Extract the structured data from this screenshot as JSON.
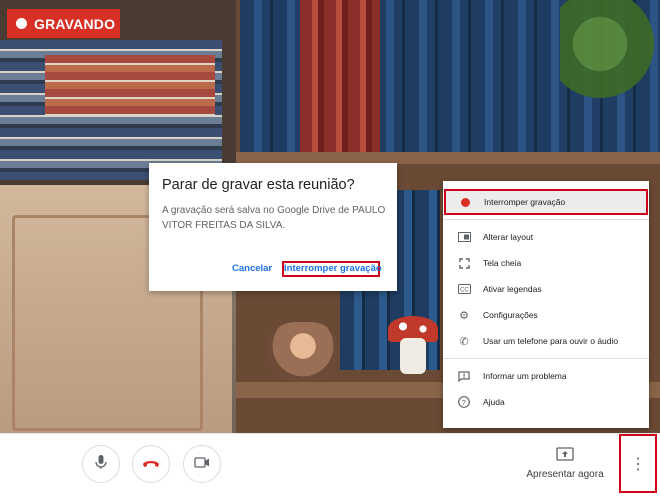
{
  "recording_badge": {
    "label": "GRAVANDO"
  },
  "dialog": {
    "title": "Parar de gravar esta reunião?",
    "body": "A gravação será salva no Google Drive de PAULO VITOR FREITAS DA SILVA.",
    "cancel_label": "Cancelar",
    "confirm_label": "Interromper gravação"
  },
  "menu": {
    "items": [
      {
        "label": "Interromper gravação",
        "icon": "record-dot-icon"
      },
      {
        "label": "Alterar layout",
        "icon": "layout-icon"
      },
      {
        "label": "Tela cheia",
        "icon": "fullscreen-icon"
      },
      {
        "label": "Ativar legendas",
        "icon": "captions-icon"
      },
      {
        "label": "Configurações",
        "icon": "gear-icon"
      },
      {
        "label": "Usar um telefone para ouvir o áudio",
        "icon": "phone-icon"
      },
      {
        "label": "Informar um problema",
        "icon": "feedback-icon"
      },
      {
        "label": "Ajuda",
        "icon": "help-icon"
      }
    ]
  },
  "bottombar": {
    "present_label": "Apresentar agora"
  },
  "colors": {
    "record_red": "#d93025",
    "highlight_red": "#d0021b",
    "link_blue": "#1a73e8"
  }
}
